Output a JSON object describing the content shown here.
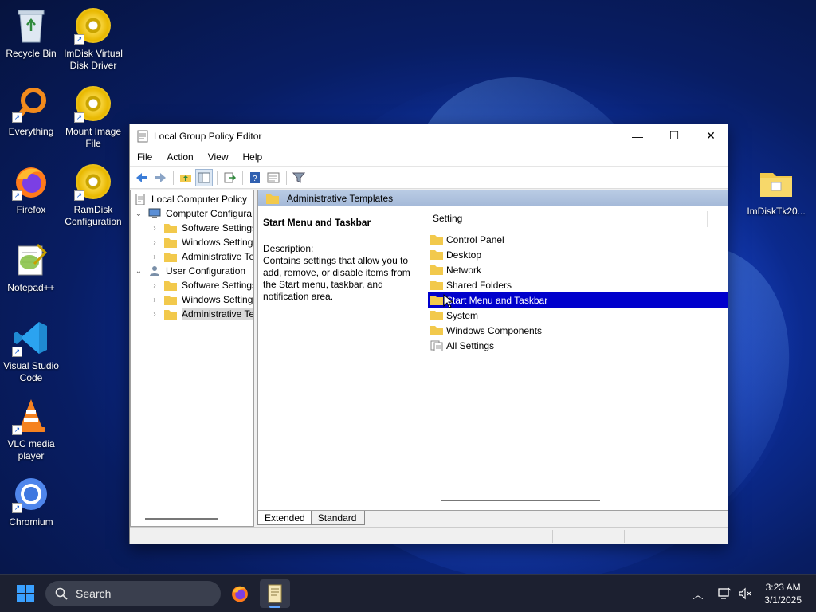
{
  "desktop": {
    "icons_left": [
      {
        "label_1": "Recycle Bin",
        "label_2": ""
      },
      {
        "label_1": "Everything",
        "label_2": ""
      },
      {
        "label_1": "Firefox",
        "label_2": ""
      },
      {
        "label_1": "Notepad++",
        "label_2": ""
      },
      {
        "label_1": "Visual Studio",
        "label_2": "Code"
      },
      {
        "label_1": "VLC media",
        "label_2": "player"
      },
      {
        "label_1": "Chromium",
        "label_2": ""
      }
    ],
    "icons_col2": [
      {
        "label_1": "ImDisk Virtual",
        "label_2": "Disk Driver"
      },
      {
        "label_1": "Mount Image",
        "label_2": "File"
      },
      {
        "label_1": "RamDisk",
        "label_2": "Configuration"
      }
    ],
    "icon_right": {
      "label": "ImDiskTk20..."
    }
  },
  "window": {
    "title": "Local Group Policy Editor",
    "controls": {
      "minimize": "—",
      "maximize": "☐",
      "close": "✕"
    },
    "menu": [
      "File",
      "Action",
      "View",
      "Help"
    ],
    "tree": {
      "root": "Local Computer Policy",
      "computer_config": "Computer Configura",
      "cc_children": [
        "Software Settings",
        "Windows Setting",
        "Administrative Te"
      ],
      "user_config": "User Configuration",
      "uc_children": [
        "Software Settings",
        "Windows Setting",
        "Administrative Te"
      ]
    },
    "right_pane": {
      "header": "Administrative Templates",
      "desc_title": "Start Menu and Taskbar",
      "desc_label": "Description:",
      "desc_text": "Contains settings that allow you to add, remove, or disable items from the Start menu, taskbar, and notification area.",
      "column_header": "Setting",
      "items": [
        "Control Panel",
        "Desktop",
        "Network",
        "Shared Folders",
        "Start Menu and Taskbar",
        "System",
        "Windows Components",
        "All Settings"
      ],
      "selected_index": 4
    },
    "tabs": [
      "Extended",
      "Standard"
    ],
    "active_tab": "Extended"
  },
  "taskbar": {
    "search_placeholder": "Search",
    "time": "3:23 AM",
    "date": "3/1/2025"
  },
  "colors": {
    "selection": "#0000cc",
    "header_band": "#b9cbe4",
    "taskbar": "#1c2030",
    "folder": "#f2c94c"
  }
}
